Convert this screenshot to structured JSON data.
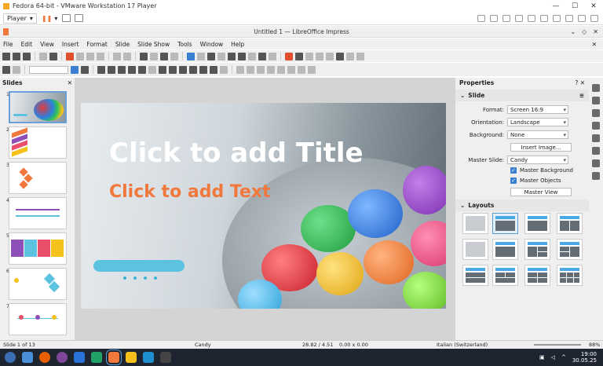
{
  "vm": {
    "title": "Fedora 64-bit - VMware Workstation 17 Player",
    "player_label": "Player",
    "icons": [
      "pause-icon",
      "send-ctrl-alt-del-icon",
      "fullscreen-icon"
    ]
  },
  "lo": {
    "window_title": "Untitled 1 — LibreOffice Impress",
    "menu": [
      "File",
      "Edit",
      "View",
      "Insert",
      "Format",
      "Slide",
      "Slide Show",
      "Tools",
      "Window",
      "Help"
    ]
  },
  "slides_pane": {
    "title": "Slides",
    "slide_numbers": [
      "1",
      "2",
      "3",
      "4",
      "5",
      "6",
      "7"
    ]
  },
  "slide": {
    "title_placeholder": "Click to add Title",
    "text_placeholder": "Click to add Text"
  },
  "sidebar": {
    "title": "Properties",
    "section_slide": "Slide",
    "format_label": "Format:",
    "format_value": "Screen 16:9",
    "orientation_label": "Orientation:",
    "orientation_value": "Landscape",
    "background_label": "Background:",
    "background_value": "None",
    "insert_image": "Insert Image...",
    "master_slide_label": "Master Slide:",
    "master_slide_value": "Candy",
    "master_background": "Master Background",
    "master_objects": "Master Objects",
    "master_view": "Master View",
    "section_layouts": "Layouts"
  },
  "status": {
    "slide_count": "Slide 1 of 13",
    "master": "Candy",
    "position": "28.82 / 4.51",
    "size": "0.00 x 0.00",
    "language": "Italian (Switzerland)",
    "zoom": "88%"
  },
  "taskbar": {
    "time": "19:00",
    "date": "30.05.25"
  },
  "colors": {
    "accent_orange": "#f0783c",
    "accent_blue": "#5bc2e0",
    "selection_blue": "#5b9bd5"
  }
}
